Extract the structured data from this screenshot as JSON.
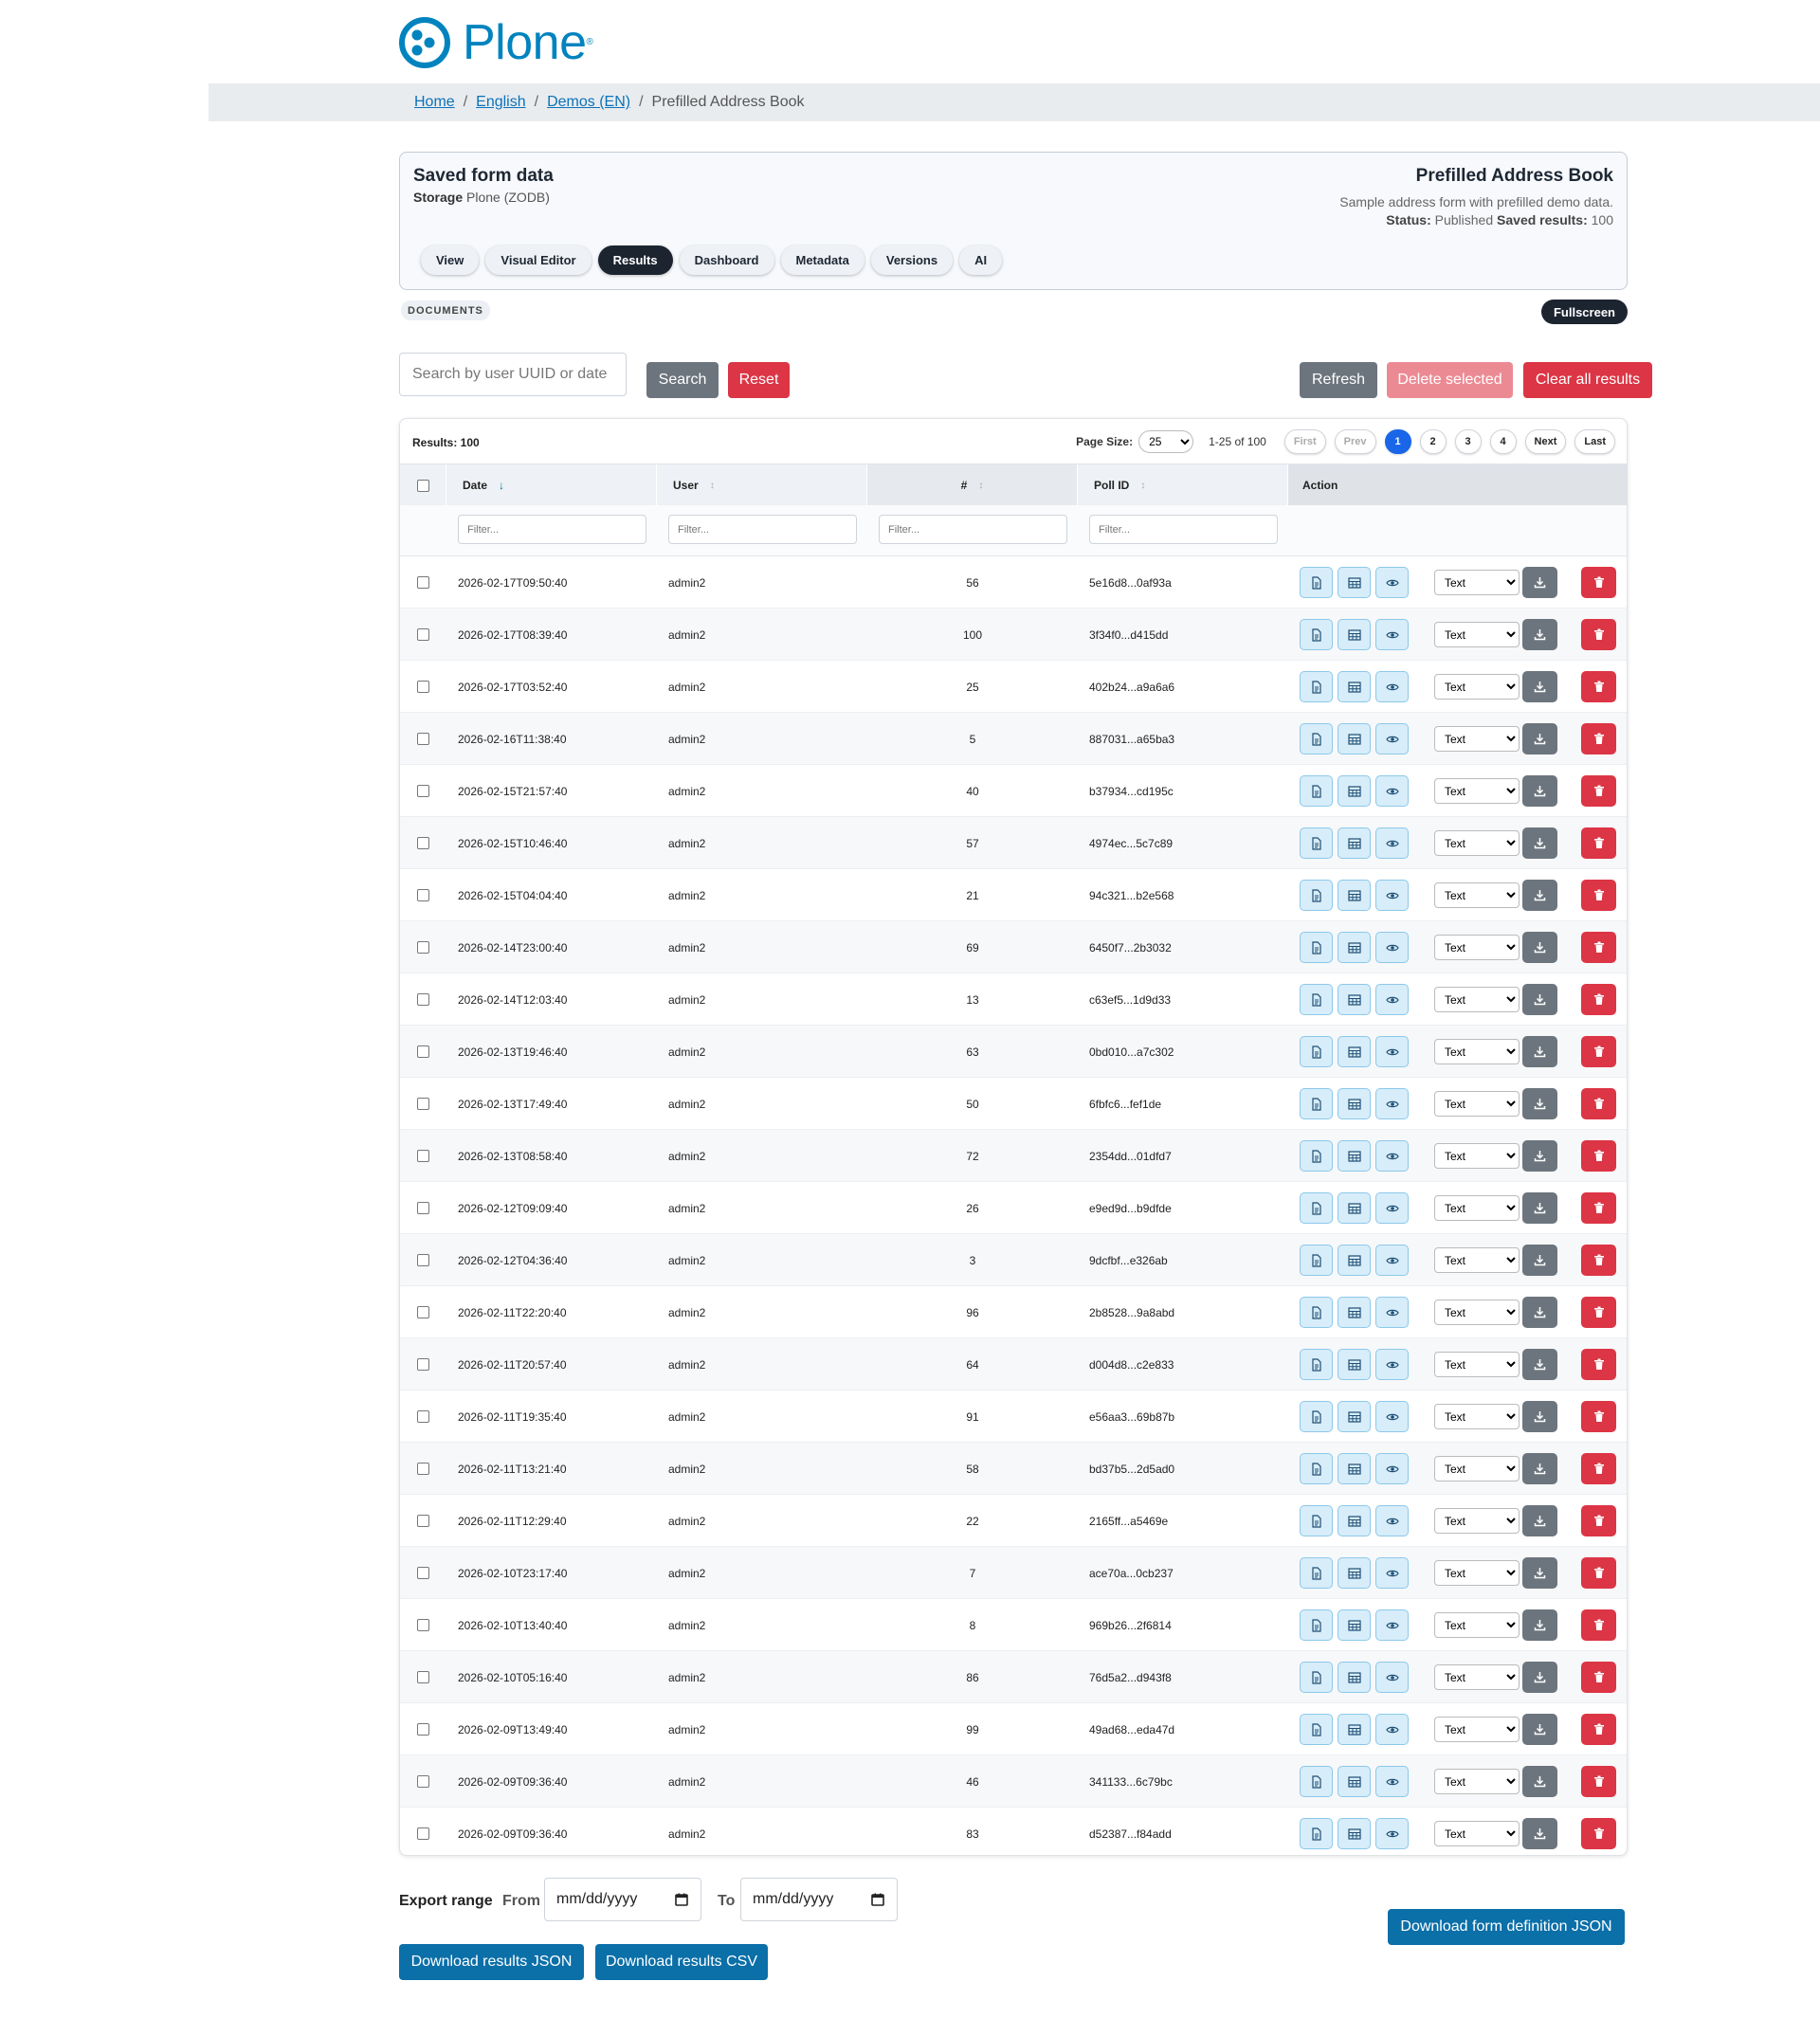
{
  "brand": {
    "name": "Plone",
    "reg": "®"
  },
  "breadcrumb": {
    "items": [
      "Home",
      "English",
      "Demos (EN)"
    ],
    "current": "Prefilled Address Book",
    "separator": "/"
  },
  "form_header": {
    "title": "Saved form data",
    "storage_label": "Storage",
    "storage_value": "Plone (ZODB)",
    "form_title": "Prefilled Address Book",
    "description": "Sample address form with prefilled demo data.",
    "status_label": "Status:",
    "status_value": "Published",
    "saved_label": "Saved results:",
    "saved_value": "100",
    "tabs": [
      "View",
      "Visual Editor",
      "Results",
      "Dashboard",
      "Metadata",
      "Versions",
      "AI"
    ],
    "active_tab": "Results"
  },
  "documents_badge": "DOCUMENTS",
  "fullscreen_label": "Fullscreen",
  "toolbar": {
    "search_placeholder": "Search by user UUID or date",
    "search_label": "Search",
    "reset_label": "Reset",
    "refresh_label": "Refresh",
    "delete_selected_label": "Delete selected",
    "clear_all_label": "Clear all results"
  },
  "results": {
    "count_label": "Results: 100",
    "page_size_label": "Page Size:",
    "page_size": "25",
    "range": "1-25 of 100",
    "first": "First",
    "prev": "Prev",
    "pages": [
      "1",
      "2",
      "3",
      "4"
    ],
    "current_page": "1",
    "next": "Next",
    "last": "Last",
    "columns": [
      "Date",
      "User",
      "#",
      "Poll ID",
      "Action"
    ],
    "filter_placeholder": "Filter...",
    "format_option": "Text",
    "rows": [
      [
        "2026-02-17T09:50:40",
        "admin2",
        "56",
        "5e16d8...0af93a"
      ],
      [
        "2026-02-17T08:39:40",
        "admin2",
        "100",
        "3f34f0...d415dd"
      ],
      [
        "2026-02-17T03:52:40",
        "admin2",
        "25",
        "402b24...a9a6a6"
      ],
      [
        "2026-02-16T11:38:40",
        "admin2",
        "5",
        "887031...a65ba3"
      ],
      [
        "2026-02-15T21:57:40",
        "admin2",
        "40",
        "b37934...cd195c"
      ],
      [
        "2026-02-15T10:46:40",
        "admin2",
        "57",
        "4974ec...5c7c89"
      ],
      [
        "2026-02-15T04:04:40",
        "admin2",
        "21",
        "94c321...b2e568"
      ],
      [
        "2026-02-14T23:00:40",
        "admin2",
        "69",
        "6450f7...2b3032"
      ],
      [
        "2026-02-14T12:03:40",
        "admin2",
        "13",
        "c63ef5...1d9d33"
      ],
      [
        "2026-02-13T19:46:40",
        "admin2",
        "63",
        "0bd010...a7c302"
      ],
      [
        "2026-02-13T17:49:40",
        "admin2",
        "50",
        "6fbfc6...fef1de"
      ],
      [
        "2026-02-13T08:58:40",
        "admin2",
        "72",
        "2354dd...01dfd7"
      ],
      [
        "2026-02-12T09:09:40",
        "admin2",
        "26",
        "e9ed9d...b9dfde"
      ],
      [
        "2026-02-12T04:36:40",
        "admin2",
        "3",
        "9dcfbf...e326ab"
      ],
      [
        "2026-02-11T22:20:40",
        "admin2",
        "96",
        "2b8528...9a8abd"
      ],
      [
        "2026-02-11T20:57:40",
        "admin2",
        "64",
        "d004d8...c2e833"
      ],
      [
        "2026-02-11T19:35:40",
        "admin2",
        "91",
        "e56aa3...69b87b"
      ],
      [
        "2026-02-11T13:21:40",
        "admin2",
        "58",
        "bd37b5...2d5ad0"
      ],
      [
        "2026-02-11T12:29:40",
        "admin2",
        "22",
        "2165ff...a5469e"
      ],
      [
        "2026-02-10T23:17:40",
        "admin2",
        "7",
        "ace70a...0cb237"
      ],
      [
        "2026-02-10T13:40:40",
        "admin2",
        "8",
        "969b26...2f6814"
      ],
      [
        "2026-02-10T05:16:40",
        "admin2",
        "86",
        "76d5a2...d943f8"
      ],
      [
        "2026-02-09T13:49:40",
        "admin2",
        "99",
        "49ad68...eda47d"
      ],
      [
        "2026-02-09T09:36:40",
        "admin2",
        "46",
        "341133...6c79bc"
      ],
      [
        "2026-02-09T09:36:40",
        "admin2",
        "83",
        "d52387...f84add"
      ]
    ]
  },
  "export": {
    "label": "Export range",
    "from_label": "From",
    "to_label": "To",
    "date_placeholder": "mm/dd/yyyy",
    "download_json": "Download results JSON",
    "download_csv": "Download results CSV",
    "download_definition": "Download form definition JSON"
  },
  "colors": {
    "brand": "#0083be",
    "danger": "#dc3545",
    "primary": "#0b6fa8",
    "dark": "#1c2430"
  }
}
